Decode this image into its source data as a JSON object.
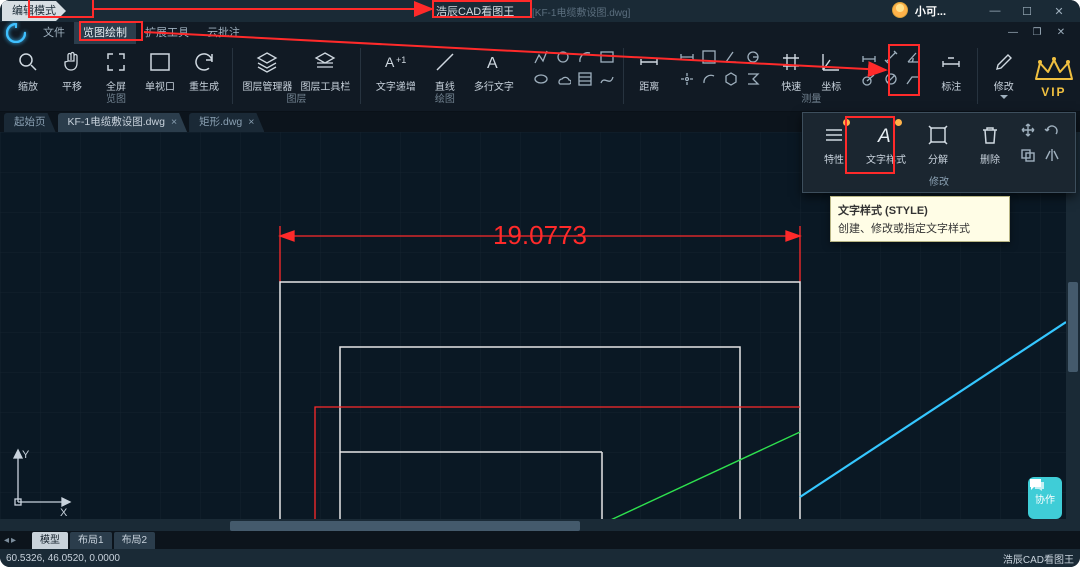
{
  "titlebar": {
    "mode": "编辑模式",
    "app_name": "浩辰CAD看图王",
    "doc_name": "[KF-1电缆敷设图.dwg]",
    "user": "小可..."
  },
  "menus": {
    "file": "文件",
    "view_draw": "览图绘制",
    "ext_tools": "扩展工具",
    "cloud": "云批注"
  },
  "ribbon": {
    "zoom": "缩放",
    "pan": "平移",
    "fullscreen": "全屏",
    "viewport": "单视口",
    "regen": "重生成",
    "layermgr": "图层管理器",
    "layertoolbar": "图层工具栏",
    "textinc": "文字递增",
    "line": "直线",
    "mtext": "多行文字",
    "distance": "距离",
    "fast": "快速",
    "coord": "坐标",
    "dim": "标注",
    "modify": "修改",
    "g_view": "览图",
    "g_layer": "图层",
    "g_draw": "绘图",
    "g_measure": "测量",
    "vip": "VIP"
  },
  "tabs": {
    "start": "起始页",
    "active": "KF-1电缆敷设图.dwg",
    "rect": "矩形.dwg"
  },
  "canvas": {
    "dim_text": "19.0773",
    "axis_y": "Y",
    "axis_x": "X",
    "side_tag": "协作"
  },
  "popover": {
    "props": "特性",
    "textstyle": "文字样式",
    "explode": "分解",
    "delete": "删除",
    "group_label": "修改"
  },
  "tooltip": {
    "title": "文字样式 (STYLE)",
    "body": "创建、修改或指定文字样式"
  },
  "modelbar": {
    "model": "模型",
    "layout1": "布局1",
    "layout2": "布局2"
  },
  "status": {
    "coords": "60.5326, 46.0520, 0.0000",
    "brand": "浩辰CAD看图王"
  }
}
